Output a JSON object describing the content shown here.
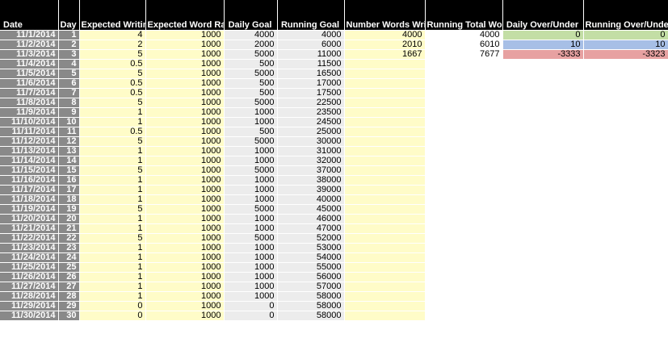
{
  "headers": {
    "date": "Date",
    "day": "Day",
    "writing_time": "Expected Writing Time (hours)",
    "word_rate": "Expected Word Rate (wph)",
    "daily_goal": "Daily Goal",
    "running_goal": "Running Goal",
    "words_written": "Number Words Written (Actual)",
    "running_total": "Running Total Words Written",
    "daily_over_under": "Daily Over/Under",
    "running_over_under": "Running Over/Under"
  },
  "colors": {
    "header_bg": "#000000",
    "date_day_bg": "#898989",
    "input_yellow": "#fffcc8",
    "calc_gray": "#ececec",
    "status_green": "#c3dea5",
    "status_blue": "#a7bfe6",
    "status_red": "#e7a1a1"
  },
  "rows": [
    {
      "date": "11/1/2014",
      "day": "1",
      "hours": "4",
      "rate": "1000",
      "daily": "4000",
      "running": "4000",
      "actual": "4000",
      "total": "4000",
      "daily_ou": "0",
      "running_ou": "0",
      "status": "green"
    },
    {
      "date": "11/2/2014",
      "day": "2",
      "hours": "2",
      "rate": "1000",
      "daily": "2000",
      "running": "6000",
      "actual": "2010",
      "total": "6010",
      "daily_ou": "10",
      "running_ou": "10",
      "status": "blue"
    },
    {
      "date": "11/3/2014",
      "day": "3",
      "hours": "5",
      "rate": "1000",
      "daily": "5000",
      "running": "11000",
      "actual": "1667",
      "total": "7677",
      "daily_ou": "-3333",
      "running_ou": "-3323",
      "status": "red"
    },
    {
      "date": "11/4/2014",
      "day": "4",
      "hours": "0.5",
      "rate": "1000",
      "daily": "500",
      "running": "11500",
      "actual": "",
      "total": "",
      "daily_ou": "",
      "running_ou": "",
      "status": ""
    },
    {
      "date": "11/5/2014",
      "day": "5",
      "hours": "5",
      "rate": "1000",
      "daily": "5000",
      "running": "16500",
      "actual": "",
      "total": "",
      "daily_ou": "",
      "running_ou": "",
      "status": ""
    },
    {
      "date": "11/6/2014",
      "day": "6",
      "hours": "0.5",
      "rate": "1000",
      "daily": "500",
      "running": "17000",
      "actual": "",
      "total": "",
      "daily_ou": "",
      "running_ou": "",
      "status": ""
    },
    {
      "date": "11/7/2014",
      "day": "7",
      "hours": "0.5",
      "rate": "1000",
      "daily": "500",
      "running": "17500",
      "actual": "",
      "total": "",
      "daily_ou": "",
      "running_ou": "",
      "status": ""
    },
    {
      "date": "11/8/2014",
      "day": "8",
      "hours": "5",
      "rate": "1000",
      "daily": "5000",
      "running": "22500",
      "actual": "",
      "total": "",
      "daily_ou": "",
      "running_ou": "",
      "status": ""
    },
    {
      "date": "11/9/2014",
      "day": "9",
      "hours": "1",
      "rate": "1000",
      "daily": "1000",
      "running": "23500",
      "actual": "",
      "total": "",
      "daily_ou": "",
      "running_ou": "",
      "status": ""
    },
    {
      "date": "11/10/2014",
      "day": "10",
      "hours": "1",
      "rate": "1000",
      "daily": "1000",
      "running": "24500",
      "actual": "",
      "total": "",
      "daily_ou": "",
      "running_ou": "",
      "status": ""
    },
    {
      "date": "11/11/2014",
      "day": "11",
      "hours": "0.5",
      "rate": "1000",
      "daily": "500",
      "running": "25000",
      "actual": "",
      "total": "",
      "daily_ou": "",
      "running_ou": "",
      "status": ""
    },
    {
      "date": "11/12/2014",
      "day": "12",
      "hours": "5",
      "rate": "1000",
      "daily": "5000",
      "running": "30000",
      "actual": "",
      "total": "",
      "daily_ou": "",
      "running_ou": "",
      "status": ""
    },
    {
      "date": "11/13/2014",
      "day": "13",
      "hours": "1",
      "rate": "1000",
      "daily": "1000",
      "running": "31000",
      "actual": "",
      "total": "",
      "daily_ou": "",
      "running_ou": "",
      "status": ""
    },
    {
      "date": "11/14/2014",
      "day": "14",
      "hours": "1",
      "rate": "1000",
      "daily": "1000",
      "running": "32000",
      "actual": "",
      "total": "",
      "daily_ou": "",
      "running_ou": "",
      "status": ""
    },
    {
      "date": "11/15/2014",
      "day": "15",
      "hours": "5",
      "rate": "1000",
      "daily": "5000",
      "running": "37000",
      "actual": "",
      "total": "",
      "daily_ou": "",
      "running_ou": "",
      "status": ""
    },
    {
      "date": "11/16/2014",
      "day": "16",
      "hours": "1",
      "rate": "1000",
      "daily": "1000",
      "running": "38000",
      "actual": "",
      "total": "",
      "daily_ou": "",
      "running_ou": "",
      "status": ""
    },
    {
      "date": "11/17/2014",
      "day": "17",
      "hours": "1",
      "rate": "1000",
      "daily": "1000",
      "running": "39000",
      "actual": "",
      "total": "",
      "daily_ou": "",
      "running_ou": "",
      "status": ""
    },
    {
      "date": "11/18/2014",
      "day": "18",
      "hours": "1",
      "rate": "1000",
      "daily": "1000",
      "running": "40000",
      "actual": "",
      "total": "",
      "daily_ou": "",
      "running_ou": "",
      "status": ""
    },
    {
      "date": "11/19/2014",
      "day": "19",
      "hours": "5",
      "rate": "1000",
      "daily": "5000",
      "running": "45000",
      "actual": "",
      "total": "",
      "daily_ou": "",
      "running_ou": "",
      "status": ""
    },
    {
      "date": "11/20/2014",
      "day": "20",
      "hours": "1",
      "rate": "1000",
      "daily": "1000",
      "running": "46000",
      "actual": "",
      "total": "",
      "daily_ou": "",
      "running_ou": "",
      "status": ""
    },
    {
      "date": "11/21/2014",
      "day": "21",
      "hours": "1",
      "rate": "1000",
      "daily": "1000",
      "running": "47000",
      "actual": "",
      "total": "",
      "daily_ou": "",
      "running_ou": "",
      "status": ""
    },
    {
      "date": "11/22/2014",
      "day": "22",
      "hours": "5",
      "rate": "1000",
      "daily": "5000",
      "running": "52000",
      "actual": "",
      "total": "",
      "daily_ou": "",
      "running_ou": "",
      "status": ""
    },
    {
      "date": "11/23/2014",
      "day": "23",
      "hours": "1",
      "rate": "1000",
      "daily": "1000",
      "running": "53000",
      "actual": "",
      "total": "",
      "daily_ou": "",
      "running_ou": "",
      "status": ""
    },
    {
      "date": "11/24/2014",
      "day": "24",
      "hours": "1",
      "rate": "1000",
      "daily": "1000",
      "running": "54000",
      "actual": "",
      "total": "",
      "daily_ou": "",
      "running_ou": "",
      "status": ""
    },
    {
      "date": "11/25/2014",
      "day": "25",
      "hours": "1",
      "rate": "1000",
      "daily": "1000",
      "running": "55000",
      "actual": "",
      "total": "",
      "daily_ou": "",
      "running_ou": "",
      "status": ""
    },
    {
      "date": "11/26/2014",
      "day": "26",
      "hours": "1",
      "rate": "1000",
      "daily": "1000",
      "running": "56000",
      "actual": "",
      "total": "",
      "daily_ou": "",
      "running_ou": "",
      "status": ""
    },
    {
      "date": "11/27/2014",
      "day": "27",
      "hours": "1",
      "rate": "1000",
      "daily": "1000",
      "running": "57000",
      "actual": "",
      "total": "",
      "daily_ou": "",
      "running_ou": "",
      "status": ""
    },
    {
      "date": "11/28/2014",
      "day": "28",
      "hours": "1",
      "rate": "1000",
      "daily": "1000",
      "running": "58000",
      "actual": "",
      "total": "",
      "daily_ou": "",
      "running_ou": "",
      "status": ""
    },
    {
      "date": "11/29/2014",
      "day": "29",
      "hours": "0",
      "rate": "1000",
      "daily": "0",
      "running": "58000",
      "actual": "",
      "total": "",
      "daily_ou": "",
      "running_ou": "",
      "status": ""
    },
    {
      "date": "11/30/2014",
      "day": "30",
      "hours": "0",
      "rate": "1000",
      "daily": "0",
      "running": "58000",
      "actual": "",
      "total": "",
      "daily_ou": "",
      "running_ou": "",
      "status": ""
    }
  ]
}
